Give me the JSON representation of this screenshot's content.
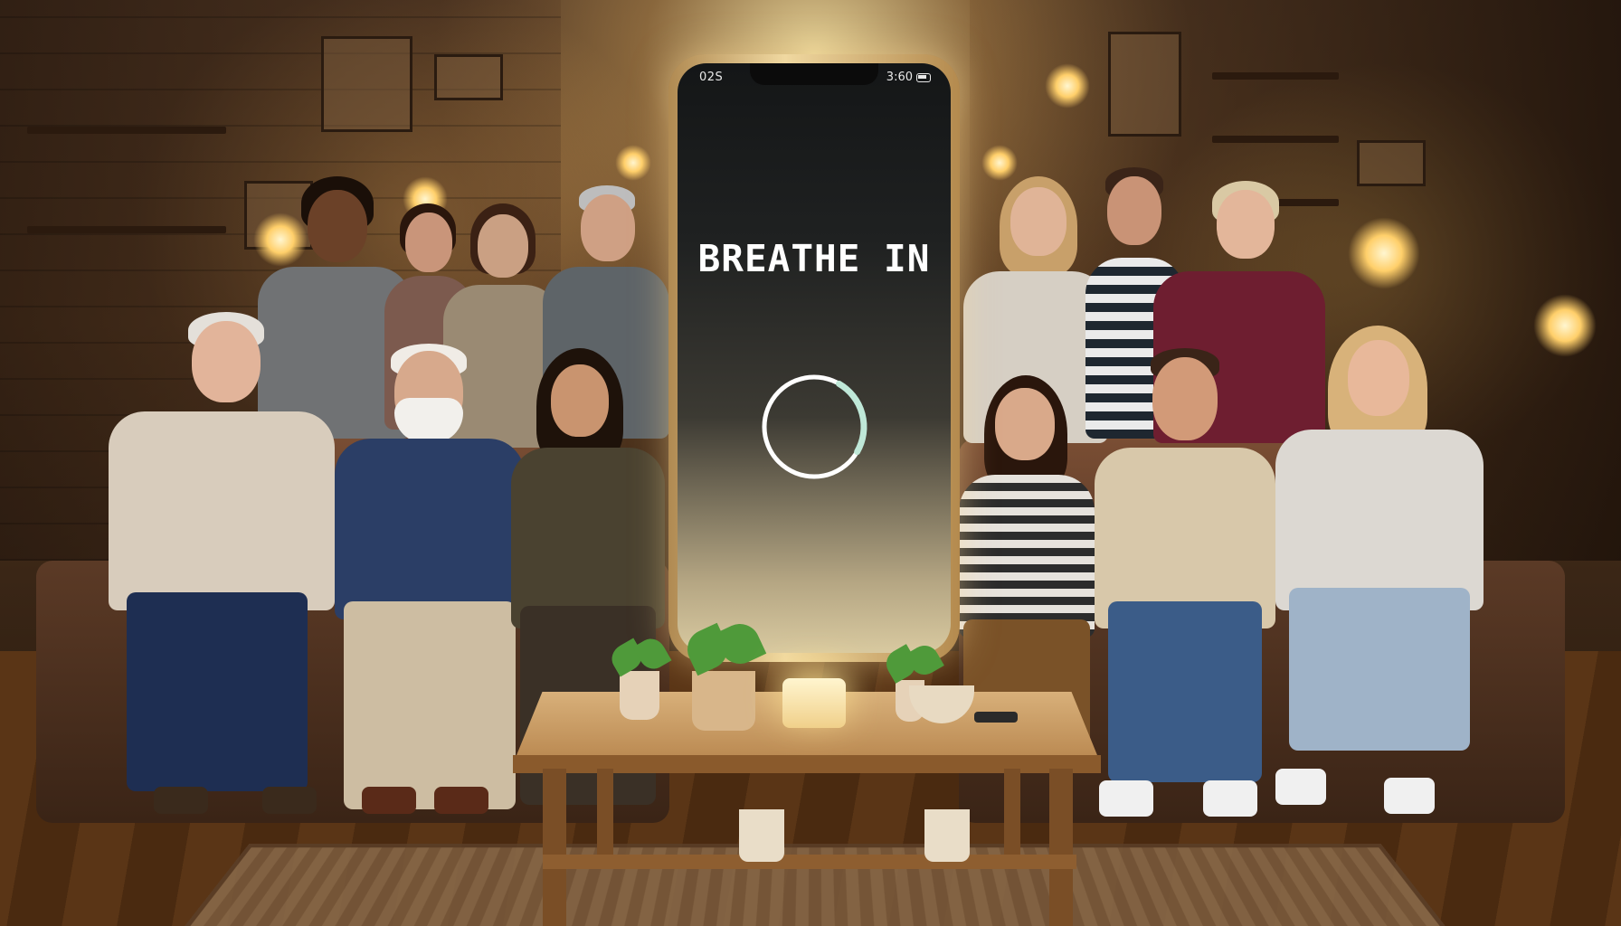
{
  "phone": {
    "status_time": "02S",
    "status_right": "3:60",
    "screen_title": "BREATHE IN",
    "breath_ring_fill": 0.25,
    "ring_accent_color": "#bfe8d8",
    "ring_color": "#ffffff"
  },
  "icons": {
    "battery": "battery-icon",
    "breath_ring": "breath-ring-icon"
  },
  "palette": {
    "warm_light": "#ffcf6a",
    "phone_frame": "#d6b77c",
    "screen_dark": "#141617"
  }
}
